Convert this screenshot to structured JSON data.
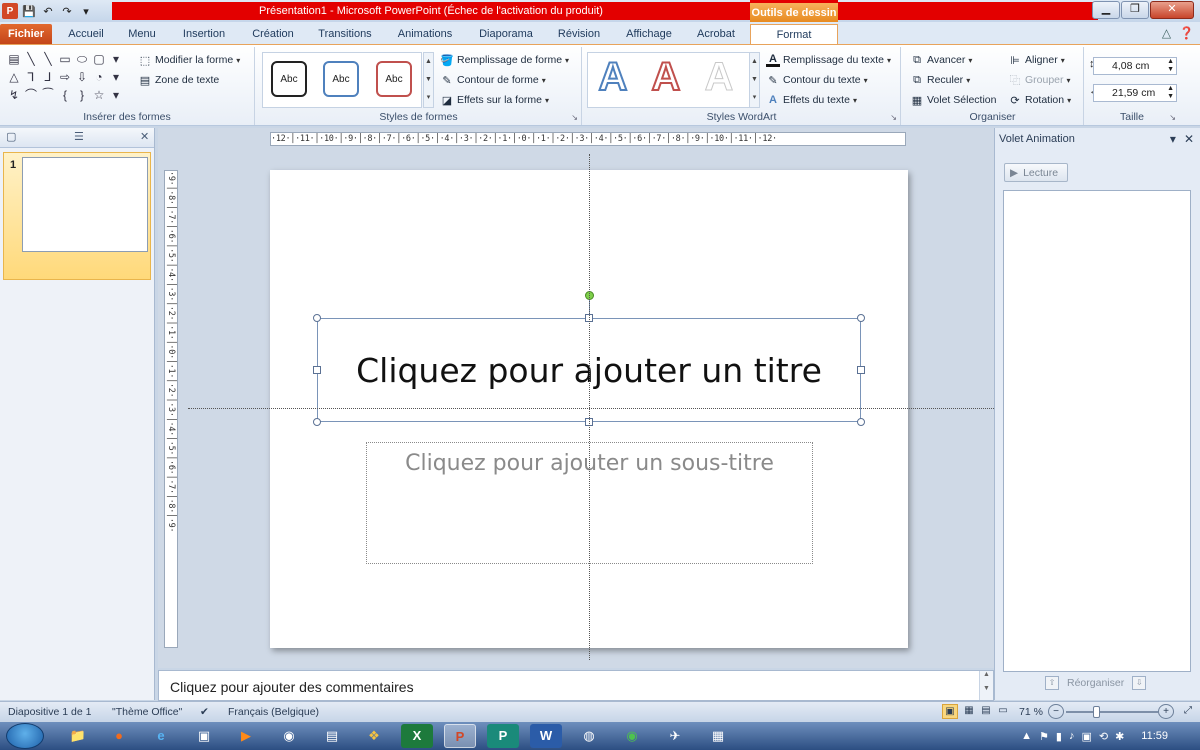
{
  "window": {
    "title": "Présentation1  -  Microsoft PowerPoint (Échec de l'activation du produit)",
    "contextual_tab": "Outils de dessin"
  },
  "tabs": [
    "Fichier",
    "Accueil",
    "Menu",
    "Insertion",
    "Création",
    "Transitions",
    "Animations",
    "Diaporama",
    "Révision",
    "Affichage",
    "Acrobat",
    "Format"
  ],
  "ribbon": {
    "insert_shapes": {
      "label": "Insérer des formes",
      "modify_shape": "Modifier la forme",
      "text_box": "Zone de texte",
      "shapes": [
        "▤",
        "╲",
        "╲",
        "▭",
        "⬭",
        "▢",
        "▾",
        "△",
        "⅂",
        "⅃",
        "⇨",
        "⇩",
        "◔",
        "▾",
        "↯",
        "⌒",
        "⁀",
        "{",
        "}",
        "☆",
        "▾"
      ]
    },
    "shape_styles": {
      "label": "Styles de formes",
      "gallery": [
        "Abc",
        "Abc",
        "Abc"
      ],
      "fill": "Remplissage de forme",
      "outline": "Contour de forme",
      "effects": "Effets sur la forme"
    },
    "wordart_styles": {
      "label": "Styles WordArt",
      "gallery": [
        "A",
        "A",
        "A"
      ],
      "text_fill": "Remplissage du texte",
      "text_outline": "Contour du texte",
      "text_effects": "Effets du texte"
    },
    "arrange": {
      "label": "Organiser",
      "forward": "Avancer",
      "backward": "Reculer",
      "selection_pane": "Volet Sélection",
      "align": "Aligner",
      "group": "Grouper",
      "rotate": "Rotation"
    },
    "size": {
      "label": "Taille",
      "height": "4,08 cm",
      "width": "21,59 cm"
    }
  },
  "slides_pane": {
    "slide_number": "1"
  },
  "ruler": {
    "horizontal": "·12·│·11·│·10·│·9·│·8·│·7·│·6·│·5·│·4·│·3·│·2·│·1·│·0·│·1·│·2·│·3·│·4·│·5·│·6·│·7·│·8·│·9·│·10·│·11·│·12·",
    "vertical": "·9·│·8·│·7·│·6·│·5·│·4·│·3·│·2·│·1·│·0·│·1·│·2·│·3·│·4·│·5·│·6·│·7·│·8·│·9·"
  },
  "slide": {
    "title_placeholder": "Cliquez pour ajouter un titre",
    "subtitle_placeholder": "Cliquez pour ajouter un sous-titre"
  },
  "notes": {
    "placeholder": "Cliquez pour ajouter des commentaires"
  },
  "animation_pane": {
    "title": "Volet Animation",
    "play": "Lecture",
    "reorder": "Réorganiser"
  },
  "status": {
    "slide_info": "Diapositive 1 de 1",
    "theme": "\"Thème Office\"",
    "language": "Français (Belgique)",
    "zoom": "71 %"
  },
  "taskbar": {
    "clock": "11:59"
  },
  "colors": {
    "accent_red": "#e30000",
    "file_tab": "#d24726",
    "contextual": "#e88a1f"
  }
}
